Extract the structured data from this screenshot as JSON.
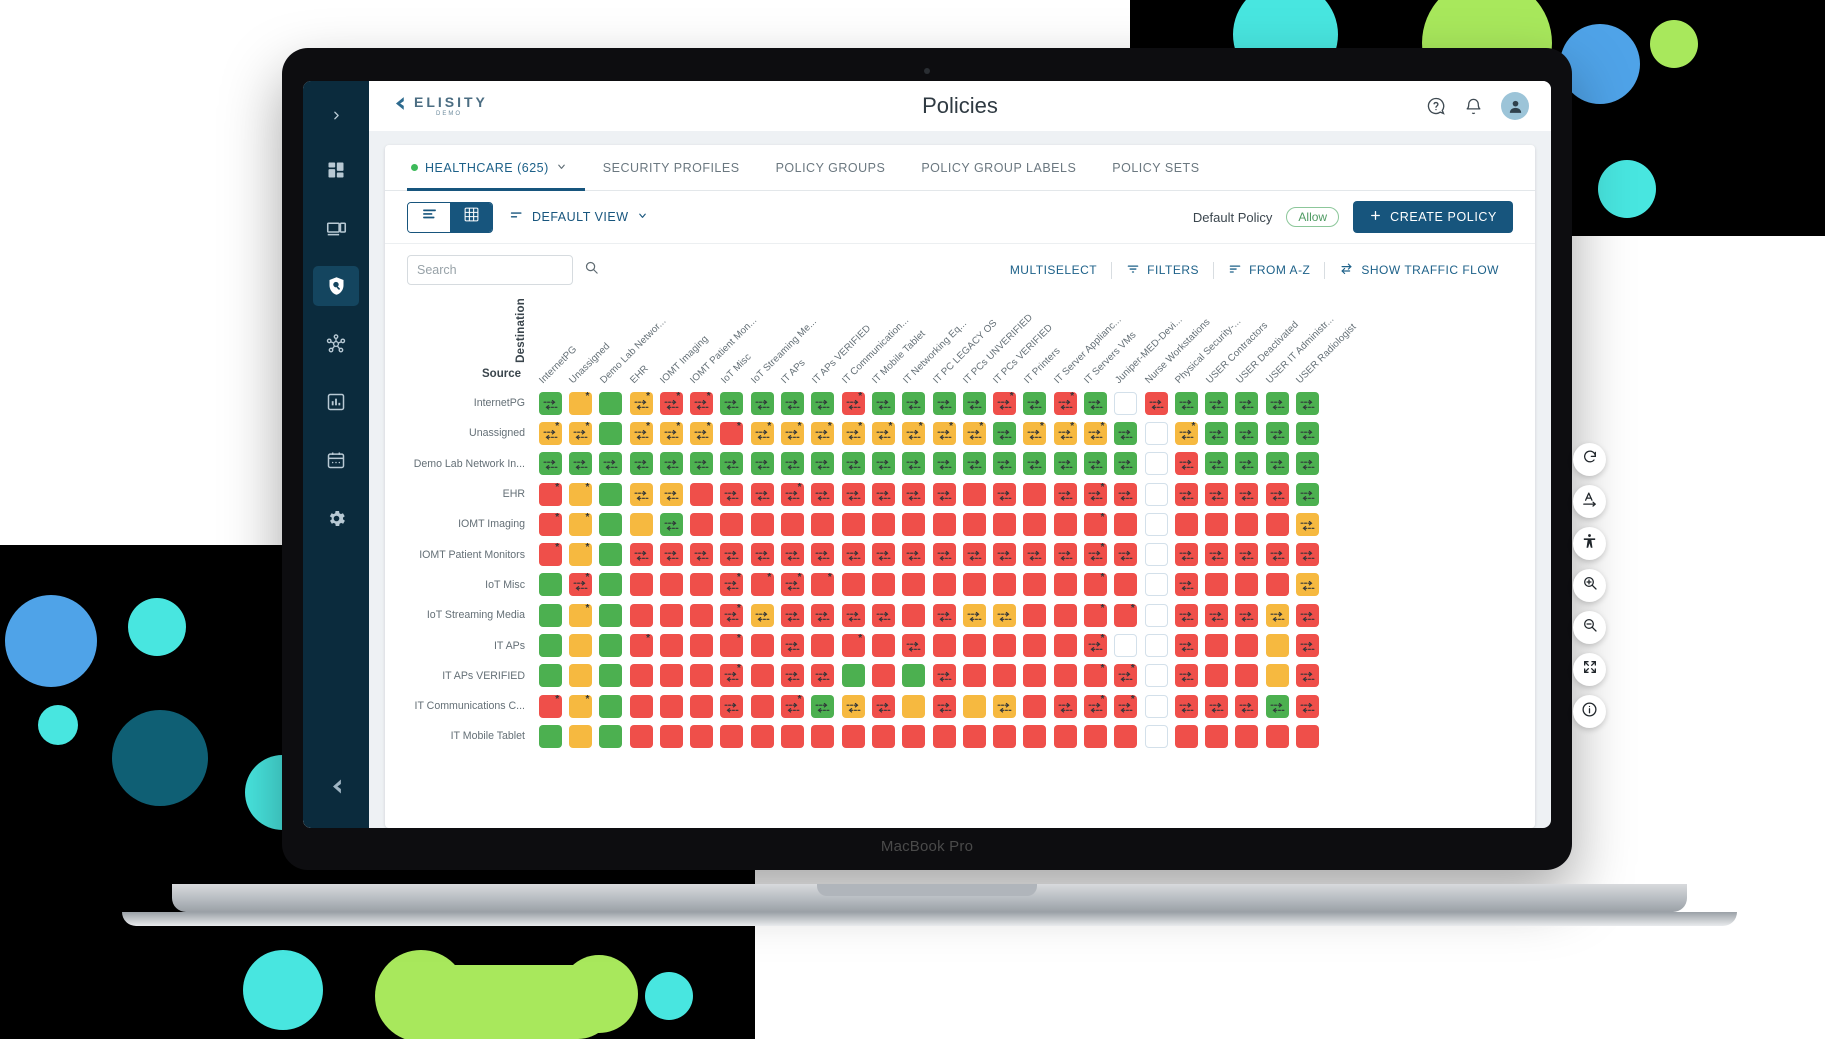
{
  "device": {
    "label": "MacBook Pro"
  },
  "brand": {
    "name": "ELISITY",
    "sub": "DEMO"
  },
  "header": {
    "title": "Policies",
    "icons": [
      "help-icon",
      "notification-bell-icon",
      "user-avatar-icon"
    ]
  },
  "sidebar": {
    "items": [
      {
        "name": "expand-sidebar",
        "icon": "chevron-right-icon",
        "active": false
      },
      {
        "name": "dashboard",
        "icon": "dashboard-grid-icon",
        "active": false
      },
      {
        "name": "devices",
        "icon": "devices-icon",
        "active": false
      },
      {
        "name": "policies",
        "icon": "shield-search-icon",
        "active": true
      },
      {
        "name": "topology",
        "icon": "network-nodes-icon",
        "active": false
      },
      {
        "name": "analytics",
        "icon": "bar-chart-icon",
        "active": false
      },
      {
        "name": "schedule",
        "icon": "calendar-icon",
        "active": false
      },
      {
        "name": "settings",
        "icon": "gear-icon",
        "active": false
      }
    ],
    "bottom": {
      "name": "collapse",
      "icon": "elisity-mark-icon"
    }
  },
  "tabs": [
    {
      "label": "HEALTHCARE (625)",
      "active": true,
      "dot": true,
      "caret": true
    },
    {
      "label": "SECURITY PROFILES",
      "active": false
    },
    {
      "label": "POLICY GROUPS",
      "active": false
    },
    {
      "label": "POLICY GROUP LABELS",
      "active": false
    },
    {
      "label": "POLICY SETS",
      "active": false
    }
  ],
  "toolbar": {
    "view_list_icon": "list-view-icon",
    "view_grid_icon": "grid-view-icon",
    "view_selector": "DEFAULT VIEW",
    "default_policy_label": "Default Policy",
    "default_policy_value": "Allow",
    "create_policy": "CREATE POLICY"
  },
  "search": {
    "placeholder": "Search",
    "value": "",
    "actions": [
      "MULTISELECT",
      "FILTERS",
      "FROM A-Z",
      "SHOW TRAFFIC FLOW"
    ]
  },
  "matrix": {
    "destination_label": "Destination",
    "source_label": "Source",
    "columns": [
      "InternetPG",
      "Unassigned",
      "Demo Lab Networ...",
      "EHR",
      "IOMT Imaging",
      "IOMT Patient Mon...",
      "IoT Misc",
      "IoT Streaming Me...",
      "IT APs",
      "IT APs VERIFIED",
      "IT Communication...",
      "IT Mobile Tablet",
      "IT Networking Eq...",
      "IT PC LEGACY OS",
      "IT PCs UNVERIFIED",
      "IT PCs VERIFIED",
      "IT Printers",
      "IT Server Applianc...",
      "IT Servers VMs",
      "Juniper-MED-Devi...",
      "Nurse Workstations",
      "Physical Security-...",
      "USER Contractors",
      "USER Deactivated",
      "USER IT Administr...",
      "USER Radiologist"
    ],
    "rows": [
      "InternetPG",
      "Unassigned",
      "Demo Lab Network In...",
      "EHR",
      "IOMT Imaging",
      "IOMT Patient Monitors",
      "IoT Misc",
      "IoT Streaming Media",
      "IT APs",
      "IT APs VERIFIED",
      "IT Communications C...",
      "IT Mobile Tablet"
    ],
    "legend": {
      "g": "allow",
      "a": "warn",
      "r": "deny",
      "n": "none"
    },
    "cells": [
      [
        "gB",
        "aS",
        "g_",
        "aBS",
        "rBS",
        "rBS",
        "gB",
        "gB",
        "gB",
        "gB",
        "rBS",
        "gB",
        "gB",
        "gB",
        "gB",
        "rBS",
        "gB",
        "rBS",
        "gB",
        "n_",
        "rB",
        "gB",
        "gB",
        "gB",
        "gB",
        "gB"
      ],
      [
        "aBS",
        "aBS",
        "g_",
        "aBS",
        "aBS",
        "aBS",
        "rS",
        "aBS",
        "aBS",
        "aBS",
        "aBS",
        "aBS",
        "aBS",
        "aBS",
        "aBS",
        "gA",
        "aBS",
        "aBS",
        "aBS",
        "gA",
        "n_",
        "aBS",
        "gB",
        "gB",
        "gB",
        "gB"
      ],
      [
        "gB",
        "gB",
        "gB",
        "gB",
        "gB",
        "gB",
        "gB",
        "gB",
        "gB",
        "gB",
        "gB",
        "gB",
        "gB",
        "gB",
        "gB",
        "gB",
        "gB",
        "gB",
        "gB",
        "gB",
        "n_",
        "rB",
        "gB",
        "gB",
        "gB",
        "gB"
      ],
      [
        "rS",
        "aS",
        "g_",
        "aB",
        "aB",
        "r_",
        "rB",
        "rB",
        "rBS",
        "rB",
        "rB",
        "rB",
        "rB",
        "rB",
        "r_",
        "rB",
        "r_",
        "rB",
        "rBS",
        "rB",
        "n_",
        "rB",
        "rB",
        "rB",
        "rB",
        "gB"
      ],
      [
        "rS",
        "aS",
        "g_",
        "a_",
        "gB",
        "r_",
        "r_",
        "r_",
        "r_",
        "r_",
        "r_",
        "r_",
        "r_",
        "r_",
        "r_",
        "r_",
        "r_",
        "r_",
        "rS",
        "r_",
        "n_",
        "r_",
        "r_",
        "r_",
        "r_",
        "aB"
      ],
      [
        "rS",
        "aS",
        "g_",
        "rB",
        "rB",
        "rB",
        "rB",
        "rB",
        "rB",
        "rB",
        "rB",
        "rB",
        "rB",
        "rB",
        "rB",
        "rB",
        "rB",
        "rB",
        "rBS",
        "rB",
        "n_",
        "rB",
        "rB",
        "rB",
        "rB",
        "rB"
      ],
      [
        "g_",
        "rBS",
        "g_",
        "r_",
        "r_",
        "r_",
        "rBS",
        "rS",
        "rBS",
        "rS",
        "r_",
        "r_",
        "r_",
        "r_",
        "r_",
        "r_",
        "r_",
        "r_",
        "rS",
        "r_",
        "n_",
        "rB",
        "r_",
        "r_",
        "r_",
        "aB"
      ],
      [
        "g_",
        "aS",
        "g_",
        "r_",
        "r_",
        "r_",
        "rBS",
        "aB",
        "rB",
        "rB",
        "rB",
        "rB",
        "r_",
        "rB",
        "aB",
        "aB",
        "r_",
        "r_",
        "rS",
        "rS",
        "n_",
        "rB",
        "rB",
        "rB",
        "aB",
        "rB"
      ],
      [
        "g_",
        "a_",
        "g_",
        "rS",
        "r_",
        "r_",
        "rS",
        "r_",
        "rB",
        "r_",
        "rS",
        "r_",
        "rB",
        "r_",
        "r_",
        "r_",
        "r_",
        "r_",
        "rBS",
        "n_",
        "n_",
        "rB",
        "r_",
        "r_",
        "a_",
        "rB"
      ],
      [
        "g_",
        "a_",
        "g_",
        "r_",
        "r_",
        "r_",
        "rBS",
        "r_",
        "rB",
        "rB",
        "g_",
        "r_",
        "g_",
        "rB",
        "r_",
        "r_",
        "r_",
        "r_",
        "rS",
        "rBS",
        "n_",
        "rB",
        "r_",
        "r_",
        "a_",
        "rB"
      ],
      [
        "rS",
        "aS",
        "g_",
        "r_",
        "r_",
        "r_",
        "rB",
        "r_",
        "rBS",
        "gB",
        "aB",
        "rB",
        "a_",
        "rB",
        "a_",
        "aB",
        "r_",
        "rB",
        "rBS",
        "rBS",
        "n_",
        "rB",
        "rB",
        "rB",
        "gB",
        "rB"
      ],
      [
        "g_",
        "a_",
        "g_",
        "r_",
        "r_",
        "r_",
        "r_",
        "r_",
        "r_",
        "r_",
        "r_",
        "r_",
        "r_",
        "r_",
        "r_",
        "r_",
        "r_",
        "r_",
        "r_",
        "r_",
        "n_",
        "r_",
        "r_",
        "r_",
        "r_",
        "r_"
      ]
    ]
  },
  "float_tools": [
    {
      "name": "refresh-icon",
      "label": "refresh"
    },
    {
      "name": "text-direction-icon",
      "label": "text direction"
    },
    {
      "name": "accessibility-icon",
      "label": "accessibility"
    },
    {
      "name": "zoom-in-icon",
      "label": "zoom in"
    },
    {
      "name": "zoom-out-icon",
      "label": "zoom out"
    },
    {
      "name": "fullscreen-icon",
      "label": "fullscreen"
    },
    {
      "name": "info-icon",
      "label": "info"
    }
  ],
  "decor": {
    "colors": {
      "black": "#000000",
      "cyan": "#48e6e0",
      "green": "#a8e85c",
      "blue": "#4fa3e8",
      "teal": "#0f5f74",
      "lightblue": "#6fc4f0"
    }
  }
}
